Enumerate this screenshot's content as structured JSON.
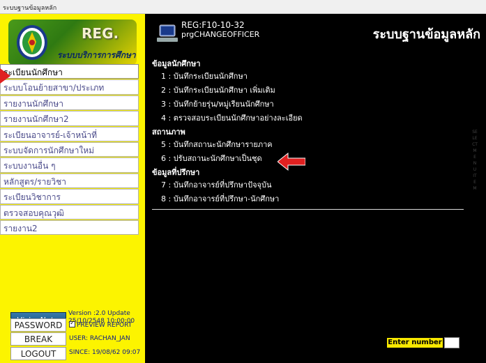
{
  "window": {
    "title": "ระบบฐานข้อมูลหลัก"
  },
  "logo": {
    "brand": "REG.",
    "subtitle": "ระบบบริการการศึกษา"
  },
  "menu": {
    "items": [
      {
        "label": "ระเบียนนักศึกษา"
      },
      {
        "label": "ระบบโอนย้ายสาขา/ประเภท"
      },
      {
        "label": "รายงานนักศึกษา"
      },
      {
        "label": "รายงานนักศึกษา2"
      },
      {
        "label": "ระเบียนอาจารย์-เจ้าหน้าที่"
      },
      {
        "label": "ระบบจัดการนักศึกษาใหม่"
      },
      {
        "label": "ระบบงานอื่น ๆ"
      },
      {
        "label": "หลักสูตร/รายวิชา"
      },
      {
        "label": "ระเบียนวิชาการ"
      },
      {
        "label": "ตรวจสอบคุณวุฒิ"
      },
      {
        "label": "รายงาน2"
      }
    ]
  },
  "footer": {
    "visionnet_label": "VisionNet",
    "version_line1": "Version :2.0 Update",
    "version_line2": "25/10/2548 10:00:00",
    "password_button": "PASSWORD",
    "preview_label": "PREVIEW REPORT",
    "break_button": "BREAK",
    "user_text": "USER: RACHAN_JAN",
    "logout_button": "LOGOUT",
    "since_text": "SINCE: 19/08/62 09:07"
  },
  "header": {
    "reg_code": "REG:F10-10-32",
    "program": "prgCHANGEOFFICER",
    "system_title": "ระบบฐานข้อมูลหลัก"
  },
  "sections": [
    {
      "title": "ข้อมูลนักศึกษา",
      "items": [
        "1 : บันทึกระเบียนนักศึกษา",
        "2 : บันทึกระเบียนนักศึกษา เพิ่มเติม",
        "3 : บันทึกย้ายรุ่น/หมู่เรียนนักศึกษา",
        "4 : ตรวจสอบระเบียนนักศึกษาอย่างละเอียด"
      ]
    },
    {
      "title": "สถานภาพ",
      "items": [
        "5 : บันทึกสถานะนักศึกษารายภาค",
        "6 : ปรับสถานะนักศึกษาเป็นชุด"
      ]
    },
    {
      "title": "ข้อมูลที่ปรึกษา",
      "items": [
        "7 : บันทึกอาจารย์ที่ปรึกษาปัจจุบัน",
        "8 : บันทึกอาจารย์ที่ปรึกษา-นักศึกษา"
      ]
    }
  ],
  "vertical_label": "SELECT MENU ITEM",
  "enter_number_label": "Enter number",
  "colors": {
    "sidebar": "#fcf400",
    "main_bg": "#000000",
    "arrow": "#e02020"
  }
}
